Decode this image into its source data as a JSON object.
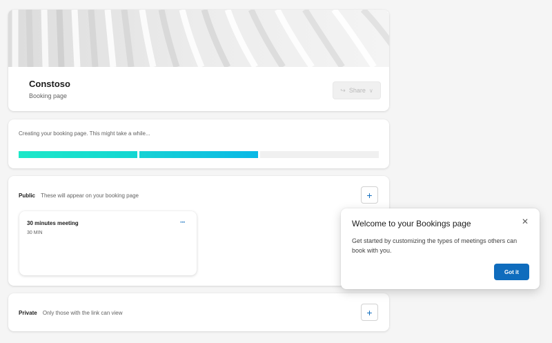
{
  "header": {
    "title": "Constoso",
    "subtitle": "Booking page",
    "share_label": "Share",
    "share_icon": "share-icon",
    "share_chevron": "chevron-down-icon"
  },
  "progress": {
    "message": "Creating your booking page. This might take a while...",
    "segments_total": 3,
    "segments_filled": 2,
    "colors": [
      "#1ce8c8",
      "#0ab8e6"
    ]
  },
  "public_section": {
    "label": "Public",
    "description": "These will appear on your booking page",
    "add_icon": "plus-icon",
    "meetings": [
      {
        "title": "30 minutes meeting",
        "duration": "30 MIN",
        "menu_icon": "more-icon"
      }
    ]
  },
  "private_section": {
    "label": "Private",
    "description": "Only those with the link can view",
    "add_icon": "plus-icon"
  },
  "popover": {
    "title": "Welcome to your Bookings page",
    "body": "Get started by customizing the types of meetings others can book with you.",
    "button_label": "Got it",
    "close_icon": "close-icon"
  },
  "colors": {
    "accent": "#0f6cbd",
    "background": "#f5f5f5"
  }
}
